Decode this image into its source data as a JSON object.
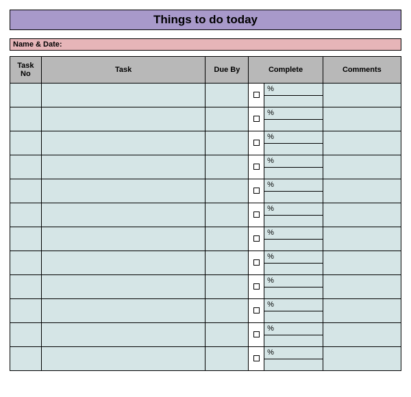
{
  "title": "Things to do today",
  "name_date_label": "Name & Date:",
  "headers": {
    "task_no": "Task No",
    "task": "Task",
    "due_by": "Due By",
    "complete": "Complete",
    "comments": "Comments"
  },
  "percent_sign": "%",
  "rows": [
    {
      "task_no": "",
      "task": "",
      "due_by": "",
      "checked": false,
      "percent": "",
      "comments": ""
    },
    {
      "task_no": "",
      "task": "",
      "due_by": "",
      "checked": false,
      "percent": "",
      "comments": ""
    },
    {
      "task_no": "",
      "task": "",
      "due_by": "",
      "checked": false,
      "percent": "",
      "comments": ""
    },
    {
      "task_no": "",
      "task": "",
      "due_by": "",
      "checked": false,
      "percent": "",
      "comments": ""
    },
    {
      "task_no": "",
      "task": "",
      "due_by": "",
      "checked": false,
      "percent": "",
      "comments": ""
    },
    {
      "task_no": "",
      "task": "",
      "due_by": "",
      "checked": false,
      "percent": "",
      "comments": ""
    },
    {
      "task_no": "",
      "task": "",
      "due_by": "",
      "checked": false,
      "percent": "",
      "comments": ""
    },
    {
      "task_no": "",
      "task": "",
      "due_by": "",
      "checked": false,
      "percent": "",
      "comments": ""
    },
    {
      "task_no": "",
      "task": "",
      "due_by": "",
      "checked": false,
      "percent": "",
      "comments": ""
    },
    {
      "task_no": "",
      "task": "",
      "due_by": "",
      "checked": false,
      "percent": "",
      "comments": ""
    },
    {
      "task_no": "",
      "task": "",
      "due_by": "",
      "checked": false,
      "percent": "",
      "comments": ""
    },
    {
      "task_no": "",
      "task": "",
      "due_by": "",
      "checked": false,
      "percent": "",
      "comments": ""
    }
  ]
}
